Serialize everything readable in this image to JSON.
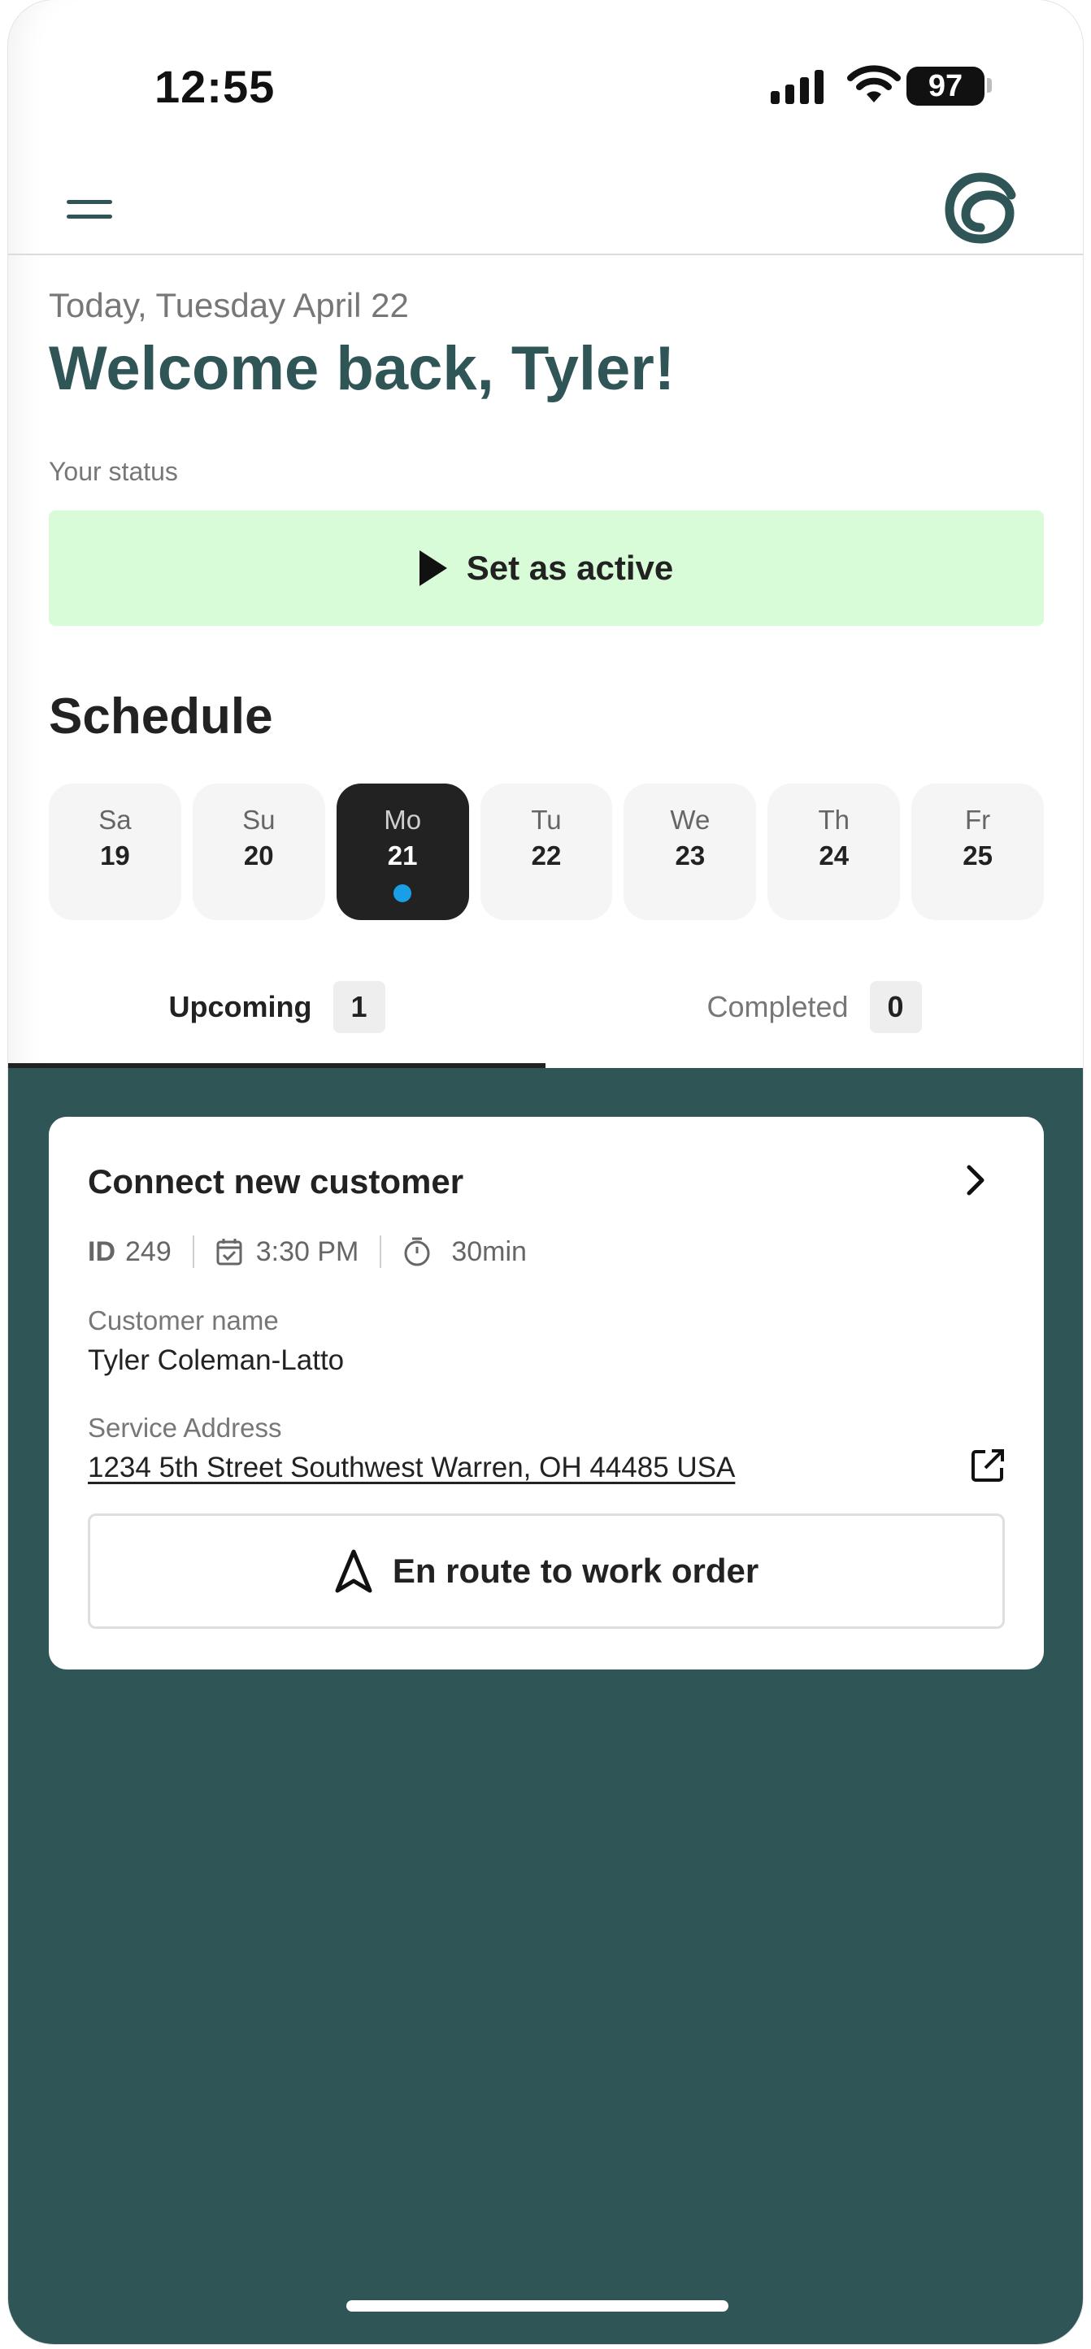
{
  "status_bar": {
    "time": "12:55",
    "battery": "97",
    "icons": [
      "signal-icon",
      "wifi-icon",
      "battery-icon"
    ]
  },
  "header": {
    "menu_icon": "hamburger-menu-icon",
    "logo_icon": "app-logo-icon",
    "colors": {
      "brand": "#2f5557"
    }
  },
  "greeting": {
    "date": "Today, Tuesday April 22",
    "welcome": "Welcome back, Tyler!"
  },
  "status": {
    "label": "Your status",
    "button": "Set as active",
    "button_icon": "play-icon",
    "button_color": "#d9fcd8"
  },
  "schedule": {
    "title": "Schedule",
    "days": [
      {
        "name": "Sa",
        "date": "19"
      },
      {
        "name": "Su",
        "date": "20"
      },
      {
        "name": "Mo",
        "date": "21",
        "selected": true,
        "has_event": true
      },
      {
        "name": "Tu",
        "date": "22"
      },
      {
        "name": "We",
        "date": "23"
      },
      {
        "name": "Th",
        "date": "24"
      },
      {
        "name": "Fr",
        "date": "25"
      }
    ]
  },
  "tabs": [
    {
      "label": "Upcoming",
      "count": "1",
      "active": true
    },
    {
      "label": "Completed",
      "count": "0",
      "active": false
    }
  ],
  "work_order": {
    "title": "Connect new customer",
    "id_label": "ID",
    "id": "249",
    "time": "3:30 PM",
    "duration": "30min",
    "customer_label": "Customer name",
    "customer_name": "Tyler Coleman-Latto",
    "address_label": "Service Address",
    "address": "1234 5th Street Southwest Warren, OH 44485 USA",
    "route_button": "En route to work order",
    "icons": [
      "chevron-right-icon",
      "calendar-icon",
      "timer-icon",
      "external-link-icon",
      "navigation-arrow-icon"
    ]
  }
}
